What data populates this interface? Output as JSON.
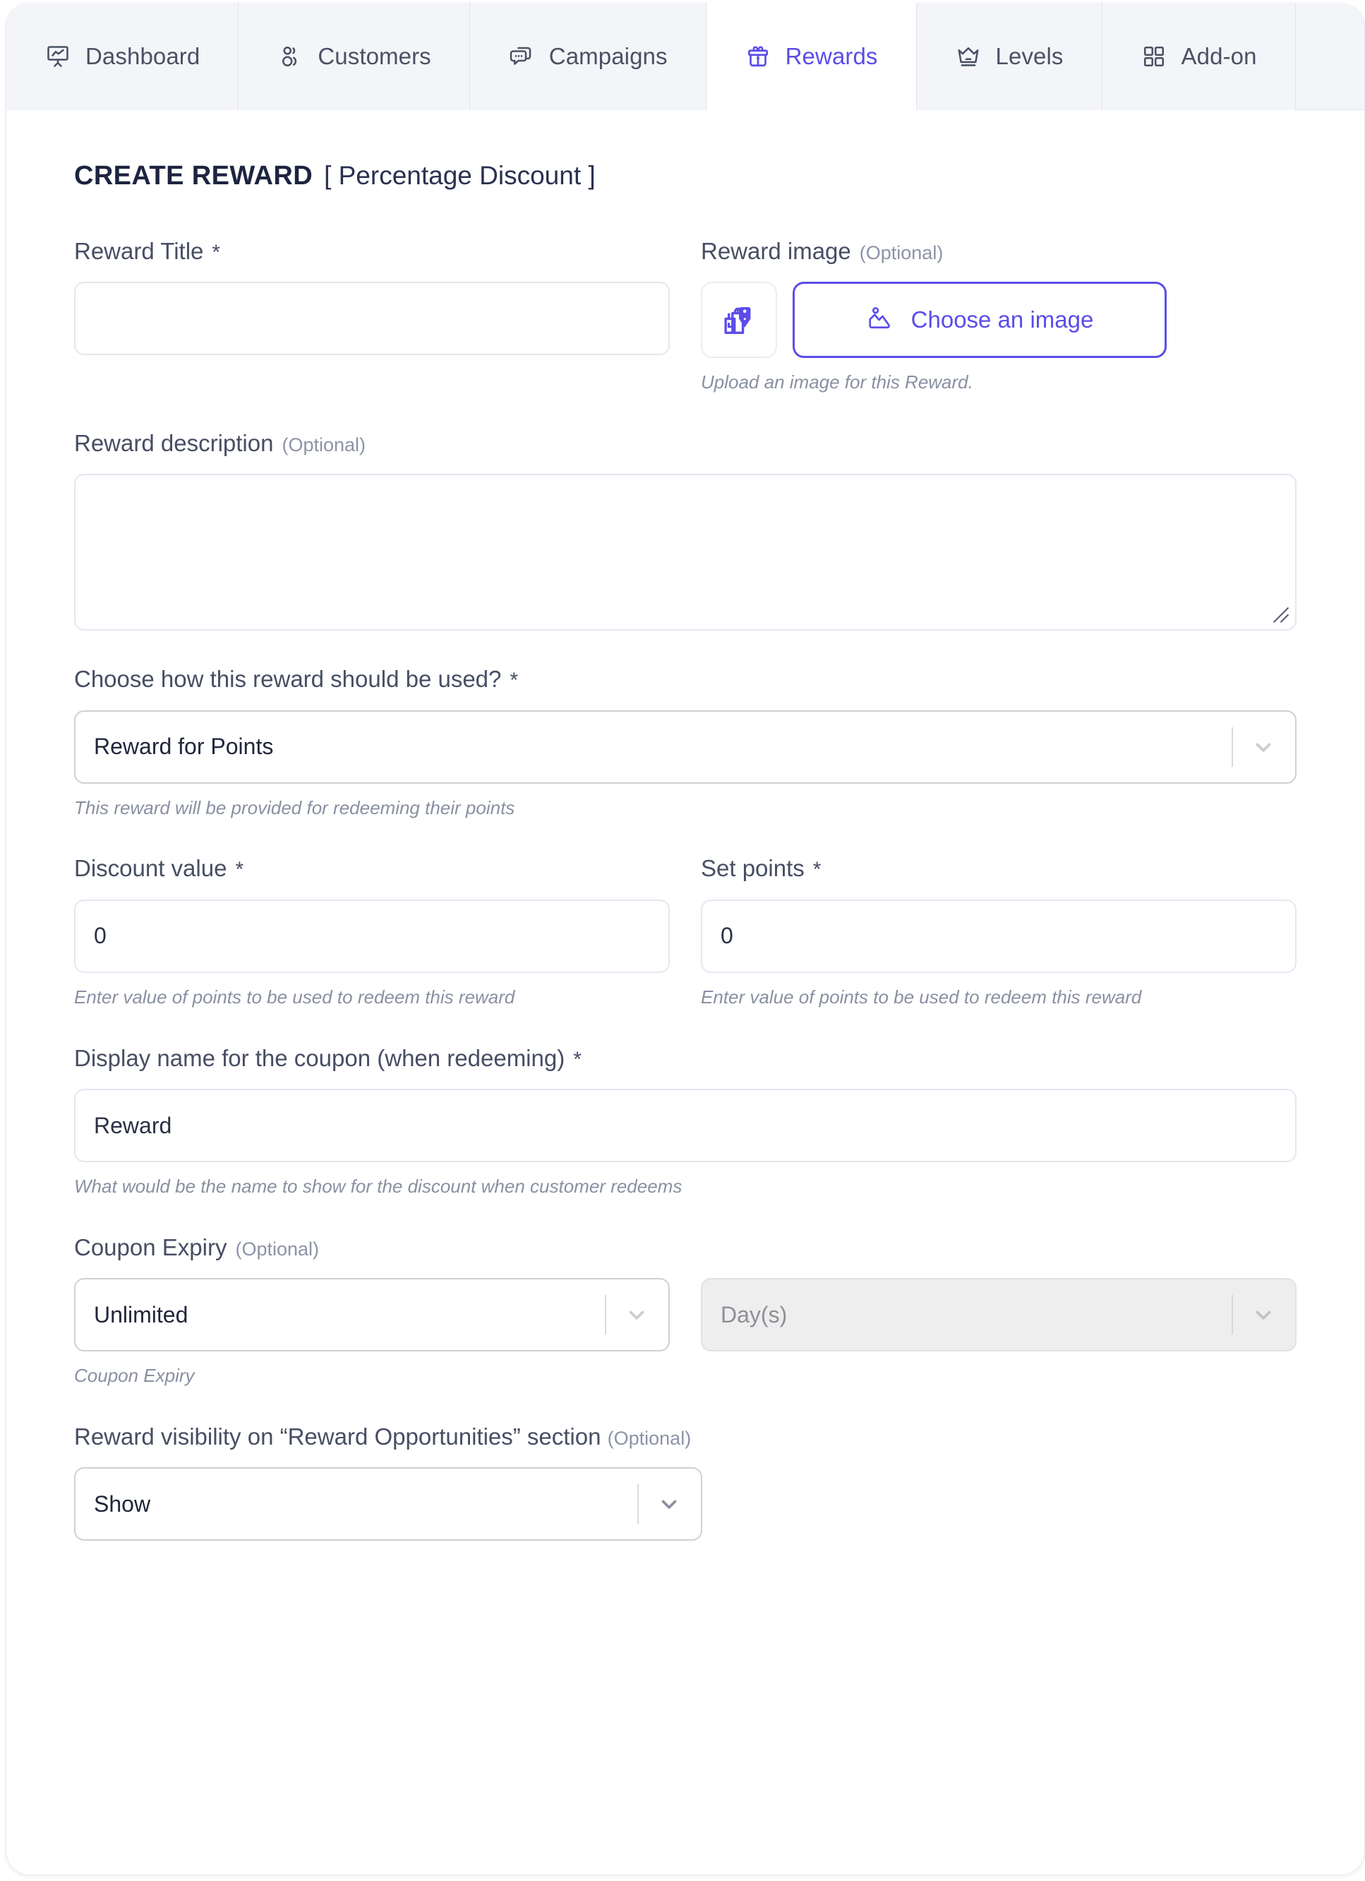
{
  "tabs": [
    {
      "label": "Dashboard",
      "icon": "presentation-chart-icon",
      "active": false
    },
    {
      "label": "Customers",
      "icon": "users-icon",
      "active": false
    },
    {
      "label": "Campaigns",
      "icon": "chat-bubbles-icon",
      "active": false
    },
    {
      "label": "Rewards",
      "icon": "gift-icon",
      "active": true
    },
    {
      "label": "Levels",
      "icon": "crown-icon",
      "active": false
    },
    {
      "label": "Add-on",
      "icon": "grid-squares-icon",
      "active": false
    }
  ],
  "header": {
    "title": "CREATE REWARD",
    "subtitle": "[ Percentage Discount ]"
  },
  "fields": {
    "reward_title": {
      "label": "Reward Title",
      "required": "*",
      "value": "",
      "placeholder": ""
    },
    "reward_image": {
      "label": "Reward image",
      "optional": "(Optional)",
      "thumb_icon": "shopping-bags-tag-icon",
      "button_icon": "image-upload-icon",
      "button_label": "Choose an image",
      "helper": "Upload an image for this Reward."
    },
    "reward_description": {
      "label": "Reward description",
      "optional": "(Optional)",
      "value": ""
    },
    "reward_usage": {
      "label": "Choose how this reward should be used?",
      "required": "*",
      "value": "Reward for Points",
      "helper": "This reward will be provided for redeeming their points"
    },
    "discount_value": {
      "label": "Discount value",
      "required": "*",
      "value": "0",
      "helper": "Enter value of points to be used to redeem this reward"
    },
    "set_points": {
      "label": "Set points",
      "required": "*",
      "value": "0",
      "helper": "Enter value of points to be used to redeem this reward"
    },
    "coupon_display_name": {
      "label": "Display name for the coupon (when redeeming)",
      "required": "*",
      "value": "Reward",
      "helper": "What would be the name to show for the discount when customer redeems"
    },
    "coupon_expiry": {
      "label": "Coupon Expiry",
      "optional": "(Optional)",
      "value": "Unlimited",
      "unit_value": "Day(s)",
      "unit_disabled": true,
      "helper": "Coupon Expiry"
    },
    "reward_visibility": {
      "label": "Reward visibility on “Reward Opportunities” section",
      "optional": "(Optional)",
      "value": "Show"
    }
  },
  "colors": {
    "accent": "#5b4de8",
    "tabbar_bg": "#f4f5f9",
    "text": "#474e63",
    "helper_text": "#8a90a2",
    "input_border": "#e7e7f1",
    "select_border": "#cfd0d6",
    "disabled_bg": "#eeeeee"
  }
}
